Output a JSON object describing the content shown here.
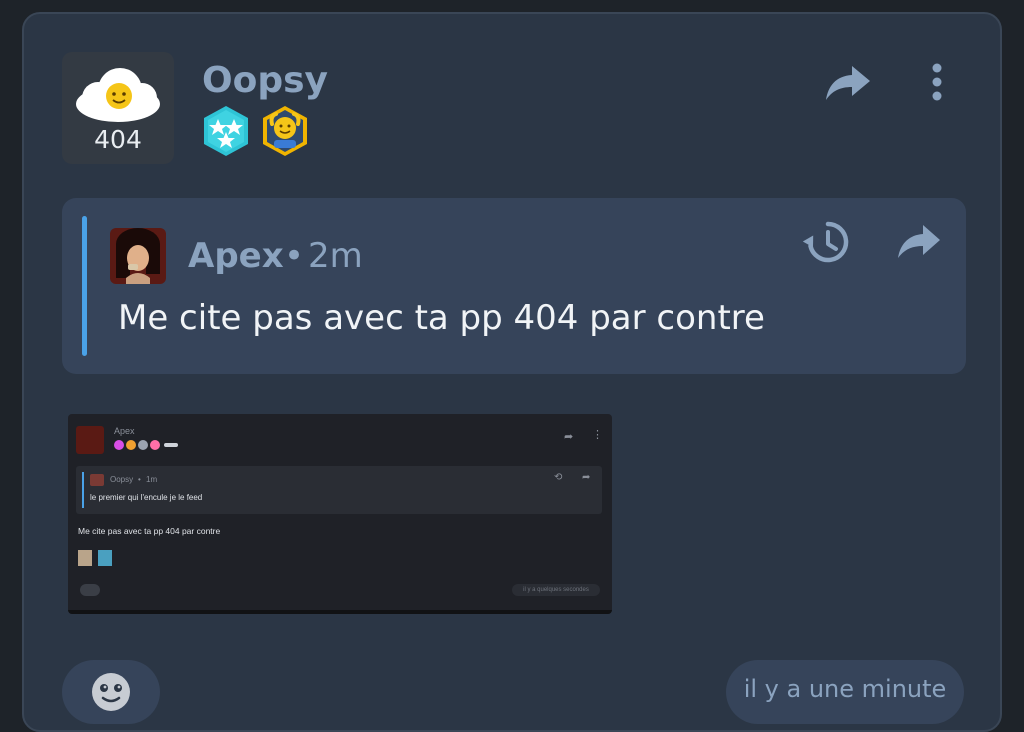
{
  "post": {
    "author": "Oopsy",
    "avatar_text": "404",
    "badges": [
      "stars-badge",
      "emoji-badge"
    ],
    "timestamp": "il y a une minute"
  },
  "quote": {
    "author": "Apex",
    "separator": "•",
    "time": "2m",
    "text": "Me cite pas avec ta pp 404 par contre"
  },
  "attachment": {
    "author": "Apex",
    "quote_author": "Oopsy",
    "quote_separator": "•",
    "quote_time": "1m",
    "quote_text": "le premier qui l'encule je le feed",
    "body_text": "Me cite pas avec ta pp 404 par contre",
    "timestamp": "il y a quelques secondes"
  },
  "colors": {
    "card_bg": "#2b3645",
    "quote_bg": "#36445a",
    "accent_bar": "#4aa2e8",
    "name_color": "#8ba3bf"
  }
}
